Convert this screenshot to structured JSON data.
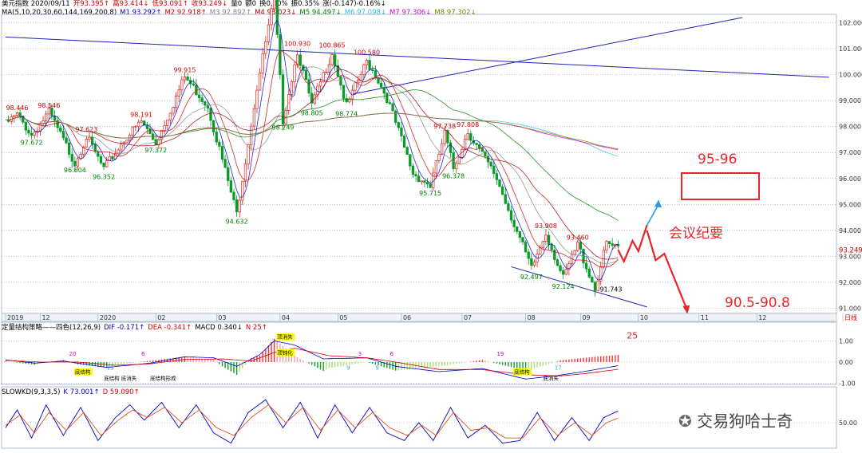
{
  "header": {
    "main_items": [
      {
        "text": "美元指数 2020/09/11",
        "color": "#000000"
      },
      {
        "text": "开93.395↑",
        "color": "#d40000"
      },
      {
        "text": "高93.414↓",
        "color": "#d40000"
      },
      {
        "text": "低93.091↑",
        "color": "#d40000"
      },
      {
        "text": "收93.249↓",
        "color": "#d40000"
      },
      {
        "text": "量0",
        "color": "#000000"
      },
      {
        "text": "额0",
        "color": "#000000"
      },
      {
        "text": "换0.00%",
        "color": "#000000"
      },
      {
        "text": "振0.35%",
        "color": "#000000"
      },
      {
        "text": "涨(-0.147)-0.16%↓",
        "color": "#000000"
      }
    ],
    "ma_items": [
      {
        "text": "MA(5,10,20,30,60,144,169,200,8)",
        "color": "#000000"
      },
      {
        "text": "M1 93.292↑",
        "color": "#0000c8"
      },
      {
        "text": "M2 92.918↑",
        "color": "#d40000"
      },
      {
        "text": "M3 92.892↑",
        "color": "#888888"
      },
      {
        "text": "M4 93.023↓",
        "color": "#a00000"
      },
      {
        "text": "M5 94.497↓",
        "color": "#008000"
      },
      {
        "text": "M6 97.098↓",
        "color": "#30c0e0"
      },
      {
        "text": "M7 97.306↓",
        "color": "#d000d0"
      },
      {
        "text": "M8 97.302↓",
        "color": "#808000"
      }
    ],
    "macd_items": [
      {
        "text": "定量结构策略——四色(12,26,9)",
        "color": "#000000"
      },
      {
        "text": "DIF -0.171↑",
        "color": "#0000c8"
      },
      {
        "text": "DEA -0.341↑",
        "color": "#d40000"
      },
      {
        "text": "MACD 0.340↓",
        "color": "#000000"
      },
      {
        "text": "N 25↑",
        "color": "#d40000"
      }
    ],
    "kd_items": [
      {
        "text": "SLOWKD(9,3,3,5)",
        "color": "#000000"
      },
      {
        "text": "K 73.001↑",
        "color": "#0000c8"
      },
      {
        "text": "D 59.090↑",
        "color": "#d40000"
      }
    ]
  },
  "annotations": {
    "target_up": "95-96",
    "target_down": "90.5-90.8",
    "event": "会议纪要",
    "watermark": "交易狗哈士奇"
  },
  "chart_data": {
    "type": "candlestick",
    "ylim": [
      90.8,
      102.2
    ],
    "yticks": [
      "102.000",
      "101.000",
      "100.000",
      "99.000",
      "98.000",
      "97.000",
      "96.000",
      "95.000",
      "94.000",
      "93.000",
      "92.000",
      "91.000"
    ],
    "ytick_values": [
      102,
      101,
      100,
      99,
      98,
      97,
      96,
      95,
      94,
      93,
      92,
      91
    ],
    "last_price": "93.249",
    "last_value": 93.249,
    "xlabels": [
      "2019",
      "12",
      "2020",
      "02",
      "03",
      "04",
      "05",
      "06",
      "07",
      "08",
      "09",
      "10",
      "11",
      "12",
      "日线"
    ],
    "xlabel_index": [
      0,
      12,
      32,
      52,
      73,
      95,
      115,
      137,
      158,
      180,
      199,
      219,
      240,
      260,
      280
    ],
    "total_bars": 285,
    "ohlc_keyframes": [
      {
        "i": 0,
        "v": 98.1
      },
      {
        "i": 4,
        "v": 98.45
      },
      {
        "i": 9,
        "v": 97.67
      },
      {
        "i": 15,
        "v": 98.55
      },
      {
        "i": 24,
        "v": 96.6
      },
      {
        "i": 28,
        "v": 97.62
      },
      {
        "i": 34,
        "v": 96.35
      },
      {
        "i": 41,
        "v": 97.5
      },
      {
        "i": 47,
        "v": 98.19
      },
      {
        "i": 52,
        "v": 97.37
      },
      {
        "i": 62,
        "v": 99.91
      },
      {
        "i": 70,
        "v": 98.8
      },
      {
        "i": 80,
        "v": 94.63
      },
      {
        "i": 87,
        "v": 99.5
      },
      {
        "i": 93,
        "v": 102.99
      },
      {
        "i": 96,
        "v": 98.25
      },
      {
        "i": 101,
        "v": 100.93
      },
      {
        "i": 106,
        "v": 98.8
      },
      {
        "i": 113,
        "v": 100.86
      },
      {
        "i": 118,
        "v": 98.77
      },
      {
        "i": 125,
        "v": 100.5
      },
      {
        "i": 128,
        "v": 100.0
      },
      {
        "i": 132,
        "v": 99.1
      },
      {
        "i": 141,
        "v": 96.2
      },
      {
        "i": 147,
        "v": 95.72
      },
      {
        "i": 152,
        "v": 97.73
      },
      {
        "i": 155,
        "v": 96.38
      },
      {
        "i": 160,
        "v": 97.81
      },
      {
        "i": 170,
        "v": 96.0
      },
      {
        "i": 182,
        "v": 92.5
      },
      {
        "i": 187,
        "v": 93.91
      },
      {
        "i": 193,
        "v": 92.13
      },
      {
        "i": 198,
        "v": 93.46
      },
      {
        "i": 204,
        "v": 91.74
      },
      {
        "i": 208,
        "v": 93.5
      },
      {
        "i": 212,
        "v": 93.25
      }
    ],
    "price_labels": [
      {
        "text": "98.446",
        "i": 4,
        "v": 98.446,
        "color": "#d40000",
        "pos": "above"
      },
      {
        "text": "98.546",
        "i": 15,
        "v": 98.546,
        "color": "#d40000",
        "pos": "above"
      },
      {
        "text": "97.672",
        "i": 9,
        "v": 97.672,
        "color": "#008000",
        "pos": "below"
      },
      {
        "text": "97.623",
        "i": 28,
        "v": 97.623,
        "color": "#d40000",
        "pos": "above"
      },
      {
        "text": "96.604",
        "i": 24,
        "v": 96.604,
        "color": "#008000",
        "pos": "below"
      },
      {
        "text": "96.352",
        "i": 34,
        "v": 96.352,
        "color": "#008000",
        "pos": "below"
      },
      {
        "text": "98.191",
        "i": 47,
        "v": 98.191,
        "color": "#d40000",
        "pos": "above"
      },
      {
        "text": "97.372",
        "i": 52,
        "v": 97.372,
        "color": "#008000",
        "pos": "below"
      },
      {
        "text": "99.915",
        "i": 62,
        "v": 99.915,
        "color": "#d40000",
        "pos": "above"
      },
      {
        "text": "94.632",
        "i": 80,
        "v": 94.632,
        "color": "#008000",
        "pos": "below"
      },
      {
        "text": "102.995",
        "i": 93,
        "v": 102.995,
        "color": "#000000",
        "pos": "right"
      },
      {
        "text": "98.249",
        "i": 96,
        "v": 98.249,
        "color": "#008000",
        "pos": "below"
      },
      {
        "text": "100.930",
        "i": 101,
        "v": 100.93,
        "color": "#d40000",
        "pos": "above"
      },
      {
        "text": "98.805",
        "i": 106,
        "v": 98.805,
        "color": "#008000",
        "pos": "below"
      },
      {
        "text": "100.865",
        "i": 113,
        "v": 100.865,
        "color": "#d40000",
        "pos": "above"
      },
      {
        "text": "98.774",
        "i": 118,
        "v": 98.774,
        "color": "#008000",
        "pos": "below"
      },
      {
        "text": "100.580",
        "i": 125,
        "v": 100.58,
        "color": "#d40000",
        "pos": "above"
      },
      {
        "text": "95.715",
        "i": 147,
        "v": 95.715,
        "color": "#008000",
        "pos": "below"
      },
      {
        "text": "97.738",
        "i": 152,
        "v": 97.738,
        "color": "#d40000",
        "pos": "above"
      },
      {
        "text": "97.808",
        "i": 160,
        "v": 97.808,
        "color": "#d40000",
        "pos": "above"
      },
      {
        "text": "96.378",
        "i": 155,
        "v": 96.378,
        "color": "#008000",
        "pos": "below"
      },
      {
        "text": "93.908",
        "i": 187,
        "v": 93.908,
        "color": "#d40000",
        "pos": "above"
      },
      {
        "text": "92.497",
        "i": 182,
        "v": 92.497,
        "color": "#008000",
        "pos": "below"
      },
      {
        "text": "93.460",
        "i": 198,
        "v": 93.46,
        "color": "#d40000",
        "pos": "above"
      },
      {
        "text": "92.124",
        "i": 193,
        "v": 92.124,
        "color": "#008000",
        "pos": "below"
      },
      {
        "text": "91.743",
        "i": 204,
        "v": 91.743,
        "color": "#000000",
        "pos": "right"
      }
    ],
    "trendlines": [
      {
        "name": "resistance",
        "from": [
          0,
          101.45
        ],
        "to": [
          285,
          99.9
        ]
      },
      {
        "name": "rising",
        "from": [
          120,
          99.25
        ],
        "to": [
          255,
          102.2
        ]
      },
      {
        "name": "support",
        "from": [
          175,
          92.6
        ],
        "to": [
          222,
          91.05
        ]
      }
    ],
    "projection": {
      "up_path": [
        [
          212,
          93.25
        ],
        [
          214,
          92.8
        ],
        [
          217,
          93.6
        ],
        [
          219,
          93.2
        ],
        [
          222,
          94.2
        ]
      ],
      "up_arrow": [
        [
          222,
          94.2
        ],
        [
          226,
          95.0
        ]
      ],
      "down_path": [
        [
          222,
          94.0
        ],
        [
          225,
          92.85
        ],
        [
          228,
          93.1
        ],
        [
          236,
          90.9
        ]
      ]
    },
    "macd": {
      "ylim": [
        -1.05,
        1.35
      ],
      "yticks": [
        "1.00",
        "0.00",
        "-1.00"
      ],
      "ytick_values": [
        1,
        0,
        -1
      ],
      "dif_keyframes": [
        [
          0,
          0.1
        ],
        [
          10,
          -0.05
        ],
        [
          20,
          0.05
        ],
        [
          35,
          -0.25
        ],
        [
          50,
          -0.05
        ],
        [
          62,
          0.25
        ],
        [
          72,
          0.2
        ],
        [
          80,
          -0.2
        ],
        [
          88,
          0.35
        ],
        [
          93,
          1.0
        ],
        [
          100,
          0.8
        ],
        [
          110,
          0.15
        ],
        [
          125,
          0.2
        ],
        [
          135,
          -0.2
        ],
        [
          150,
          -0.45
        ],
        [
          165,
          -0.3
        ],
        [
          180,
          -0.8
        ],
        [
          190,
          -0.65
        ],
        [
          200,
          -0.45
        ],
        [
          212,
          -0.17
        ]
      ],
      "dea_keyframes": [
        [
          0,
          0.08
        ],
        [
          12,
          0.0
        ],
        [
          25,
          0.0
        ],
        [
          38,
          -0.15
        ],
        [
          50,
          -0.08
        ],
        [
          62,
          0.12
        ],
        [
          75,
          0.15
        ],
        [
          85,
          0.05
        ],
        [
          93,
          0.45
        ],
        [
          100,
          0.65
        ],
        [
          112,
          0.3
        ],
        [
          125,
          0.2
        ],
        [
          135,
          0.0
        ],
        [
          150,
          -0.35
        ],
        [
          165,
          -0.35
        ],
        [
          180,
          -0.6
        ],
        [
          192,
          -0.65
        ],
        [
          200,
          -0.55
        ],
        [
          212,
          -0.34
        ]
      ],
      "labels": [
        {
          "text": "20",
          "i": 22,
          "v": 0.3,
          "color": "#d000d0"
        },
        {
          "text": "6",
          "i": 47,
          "v": 0.3,
          "color": "#d000d0"
        },
        {
          "text": "8",
          "i": 98,
          "v": 0.3,
          "color": "#d000d0"
        },
        {
          "text": "3",
          "i": 122,
          "v": 0.3,
          "color": "#d000d0"
        },
        {
          "text": "6",
          "i": 133,
          "v": 0.3,
          "color": "#d000d0"
        },
        {
          "text": "19",
          "i": 170,
          "v": 0.3,
          "color": "#d000d0"
        },
        {
          "text": "13",
          "i": 35,
          "v": -0.35,
          "color": "#20b0d0"
        },
        {
          "text": "9",
          "i": 118,
          "v": -0.35,
          "color": "#20b0d0"
        },
        {
          "text": "9",
          "i": 128,
          "v": -0.35,
          "color": "#20b0d0"
        },
        {
          "text": "17",
          "i": 190,
          "v": -0.35,
          "color": "#20b0d0"
        },
        {
          "text": "25",
          "i": 215,
          "v": 1.1,
          "color": "#e8262a",
          "big": true
        }
      ],
      "notes": [
        {
          "text": "底结构",
          "i": 24,
          "v": -0.55,
          "color": "#000000",
          "bg": "#ffff00"
        },
        {
          "text": "底结构",
          "i": 34,
          "v": -0.85,
          "color": "#000000"
        },
        {
          "text": "底消失",
          "i": 40,
          "v": -0.85,
          "color": "#000000"
        },
        {
          "text": "底结构形成",
          "i": 50,
          "v": -0.85,
          "color": "#000000"
        },
        {
          "text": "顶消失",
          "i": 94,
          "v": 1.1,
          "color": "#000000",
          "bg": "#ffff00"
        },
        {
          "text": "顶钝化",
          "i": 94,
          "v": 0.35,
          "color": "#000000",
          "bg": "#ffff00"
        },
        {
          "text": "底结构",
          "i": 176,
          "v": -0.55,
          "color": "#000000",
          "bg": "#ffff00"
        },
        {
          "text": "底消失",
          "i": 186,
          "v": -0.85,
          "color": "#000000"
        }
      ]
    },
    "kd": {
      "ylim": [
        0,
        100
      ],
      "yticks": [
        "50.00"
      ],
      "ytick_values": [
        50
      ],
      "k_keyframes": [
        [
          0,
          40
        ],
        [
          4,
          75
        ],
        [
          9,
          20
        ],
        [
          14,
          85
        ],
        [
          20,
          25
        ],
        [
          26,
          80
        ],
        [
          32,
          15
        ],
        [
          38,
          60
        ],
        [
          43,
          85
        ],
        [
          48,
          55
        ],
        [
          54,
          90
        ],
        [
          60,
          40
        ],
        [
          66,
          85
        ],
        [
          72,
          30
        ],
        [
          78,
          10
        ],
        [
          84,
          70
        ],
        [
          90,
          95
        ],
        [
          96,
          40
        ],
        [
          102,
          90
        ],
        [
          108,
          20
        ],
        [
          114,
          85
        ],
        [
          120,
          30
        ],
        [
          126,
          80
        ],
        [
          132,
          30
        ],
        [
          138,
          15
        ],
        [
          143,
          50
        ],
        [
          148,
          15
        ],
        [
          154,
          80
        ],
        [
          160,
          20
        ],
        [
          166,
          45
        ],
        [
          172,
          10
        ],
        [
          178,
          15
        ],
        [
          184,
          70
        ],
        [
          190,
          15
        ],
        [
          196,
          60
        ],
        [
          202,
          15
        ],
        [
          207,
          60
        ],
        [
          212,
          73
        ]
      ],
      "d_keyframes": [
        [
          0,
          45
        ],
        [
          5,
          65
        ],
        [
          10,
          30
        ],
        [
          15,
          70
        ],
        [
          21,
          35
        ],
        [
          27,
          70
        ],
        [
          33,
          25
        ],
        [
          39,
          55
        ],
        [
          44,
          75
        ],
        [
          49,
          60
        ],
        [
          55,
          80
        ],
        [
          61,
          50
        ],
        [
          67,
          75
        ],
        [
          73,
          40
        ],
        [
          79,
          25
        ],
        [
          85,
          60
        ],
        [
          91,
          85
        ],
        [
          97,
          50
        ],
        [
          103,
          80
        ],
        [
          109,
          35
        ],
        [
          115,
          75
        ],
        [
          121,
          40
        ],
        [
          127,
          70
        ],
        [
          133,
          40
        ],
        [
          139,
          25
        ],
        [
          144,
          45
        ],
        [
          149,
          25
        ],
        [
          155,
          70
        ],
        [
          161,
          35
        ],
        [
          167,
          40
        ],
        [
          173,
          20
        ],
        [
          179,
          20
        ],
        [
          185,
          60
        ],
        [
          191,
          25
        ],
        [
          197,
          50
        ],
        [
          203,
          25
        ],
        [
          208,
          50
        ],
        [
          212,
          59
        ]
      ]
    }
  }
}
